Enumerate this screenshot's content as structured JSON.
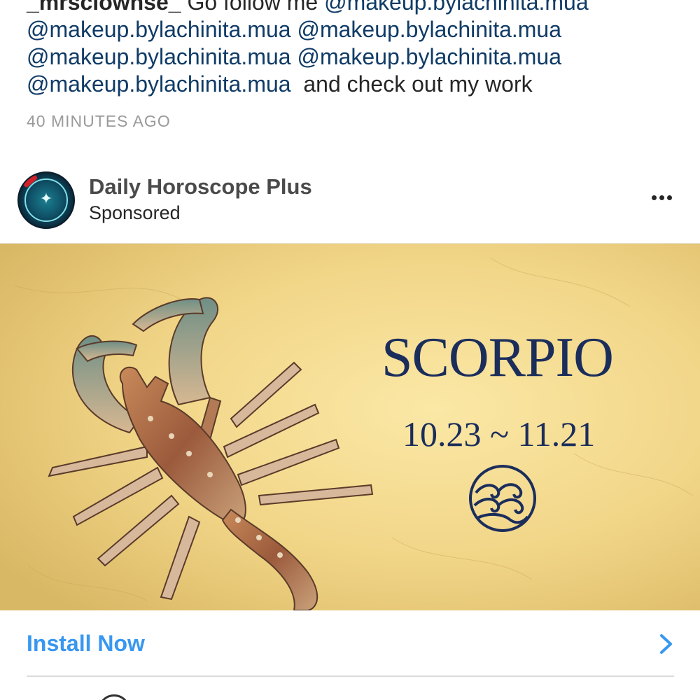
{
  "caption": {
    "username": "_mrsclownse_",
    "intro_text": " Go follow me ",
    "mentions": [
      "@makeup.bylachinita.mua",
      "@makeup.bylachinita.mua",
      "@makeup.bylachinita.mua",
      "@makeup.bylachinita.mua",
      "@makeup.bylachinita.mua",
      "@makeup.bylachinita.mua"
    ],
    "outro_text": "  and check out my work",
    "timestamp": "40 MINUTES AGO"
  },
  "post": {
    "account_name": "Daily Horoscope Plus",
    "sponsored_label": "Sponsored",
    "more_icon": "more-horizontal-icon",
    "image": {
      "title": "SCORPIO",
      "dates": "10.23 ~ 11.21",
      "symbol_icon": "water-waves-icon",
      "subject": "scorpion-illustration"
    },
    "cta": {
      "label": "Install Now",
      "icon": "chevron-right-icon"
    }
  },
  "colors": {
    "mention": "#0f3b66",
    "cta": "#3897f0",
    "timestamp": "#9a9a9a",
    "ad_title": "#1b2d5b",
    "parchment": "#f1d587"
  }
}
